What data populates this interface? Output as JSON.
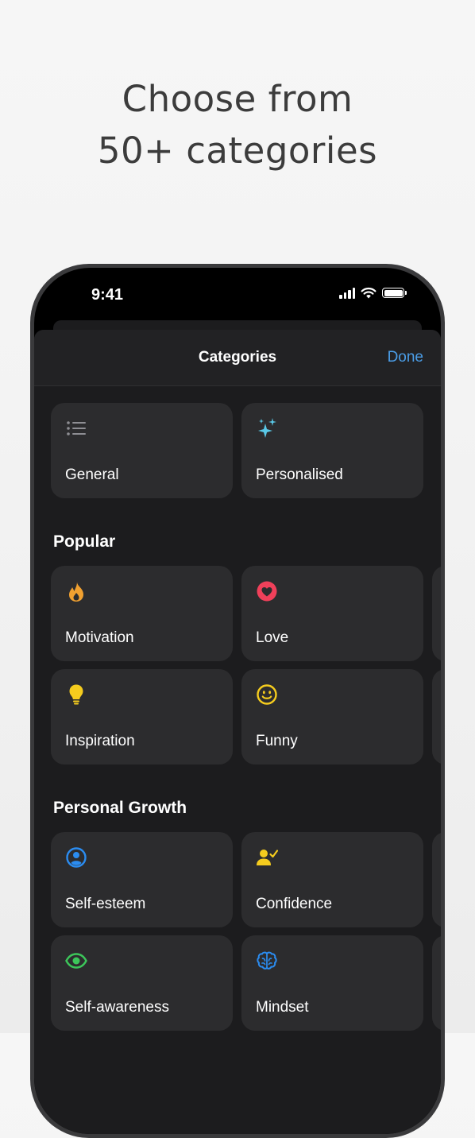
{
  "headline": {
    "line1": "Choose from",
    "line2": "50+ categories"
  },
  "status_bar": {
    "time": "9:41",
    "icons": [
      "cellular-signal-icon",
      "wifi-icon",
      "battery-icon"
    ]
  },
  "nav": {
    "title": "Categories",
    "done_label": "Done"
  },
  "top_categories": [
    {
      "label": "General",
      "icon": "list-icon",
      "color": "#8e8e93"
    },
    {
      "label": "Personalised",
      "icon": "sparkles-icon",
      "color": "#5ac8e6"
    }
  ],
  "sections": [
    {
      "title": "Popular",
      "items": [
        {
          "label": "Motivation",
          "icon": "flame-icon",
          "color": "#f0a030"
        },
        {
          "label": "Love",
          "icon": "heart-icon",
          "color": "#f0405a"
        },
        {
          "label": "Inspiration",
          "icon": "lightbulb-icon",
          "color": "#f5cc1e"
        },
        {
          "label": "Funny",
          "icon": "smiley-icon",
          "color": "#f5cc1e"
        }
      ]
    },
    {
      "title": "Personal Growth",
      "items": [
        {
          "label": "Self-esteem",
          "icon": "person-circle-icon",
          "color": "#2b8cf0"
        },
        {
          "label": "Confidence",
          "icon": "person-check-icon",
          "color": "#f5cc1e"
        },
        {
          "label": "Self-awareness",
          "icon": "eye-icon",
          "color": "#3cc65a"
        },
        {
          "label": "Mindset",
          "icon": "brain-icon",
          "color": "#2b8cf0"
        }
      ]
    }
  ],
  "colors": {
    "sheet_background": "#1c1c1e",
    "card_background": "#2c2c2e",
    "accent": "#4b9ee8"
  }
}
